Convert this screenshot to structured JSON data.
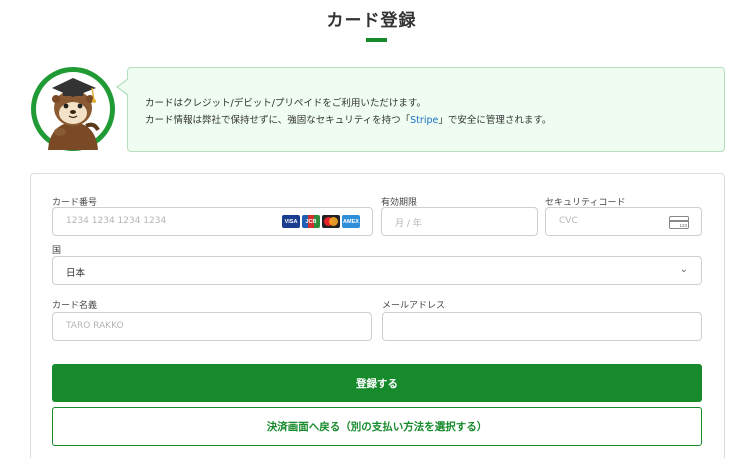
{
  "page": {
    "title": "カード登録",
    "accent_color": "#178a2c"
  },
  "notice": {
    "line1": "カードはクレジット/デビット/プリペイドをご利用いただけます。",
    "line2_before": "カード情報は弊社で保持せずに、強固なセキュリティを持つ「",
    "line2_link": "Stripe",
    "line2_after": "」で安全に管理されます。",
    "mascot_icon": "sea-otter-graduate-icon"
  },
  "form": {
    "card_number": {
      "label": "カード番号",
      "placeholder": "1234 1234 1234 1234",
      "brand_icons": [
        "visa-icon",
        "jcb-icon",
        "mastercard-icon",
        "amex-icon"
      ],
      "brand_texts": [
        "VISA",
        "JCB",
        "",
        "AMEX"
      ]
    },
    "expiry": {
      "label": "有効期限",
      "placeholder": "月 / 年"
    },
    "security_code": {
      "label": "セキュリティコード",
      "placeholder": "CVC",
      "icon_text": "123"
    },
    "country": {
      "label": "国",
      "value": "日本"
    },
    "card_name": {
      "label": "カード名義",
      "placeholder": "TARO RAKKO"
    },
    "email": {
      "label": "メールアドレス",
      "placeholder": ""
    }
  },
  "buttons": {
    "register": "登録する",
    "back": "決済画面へ戻る（別の支払い方法を選択する）"
  }
}
